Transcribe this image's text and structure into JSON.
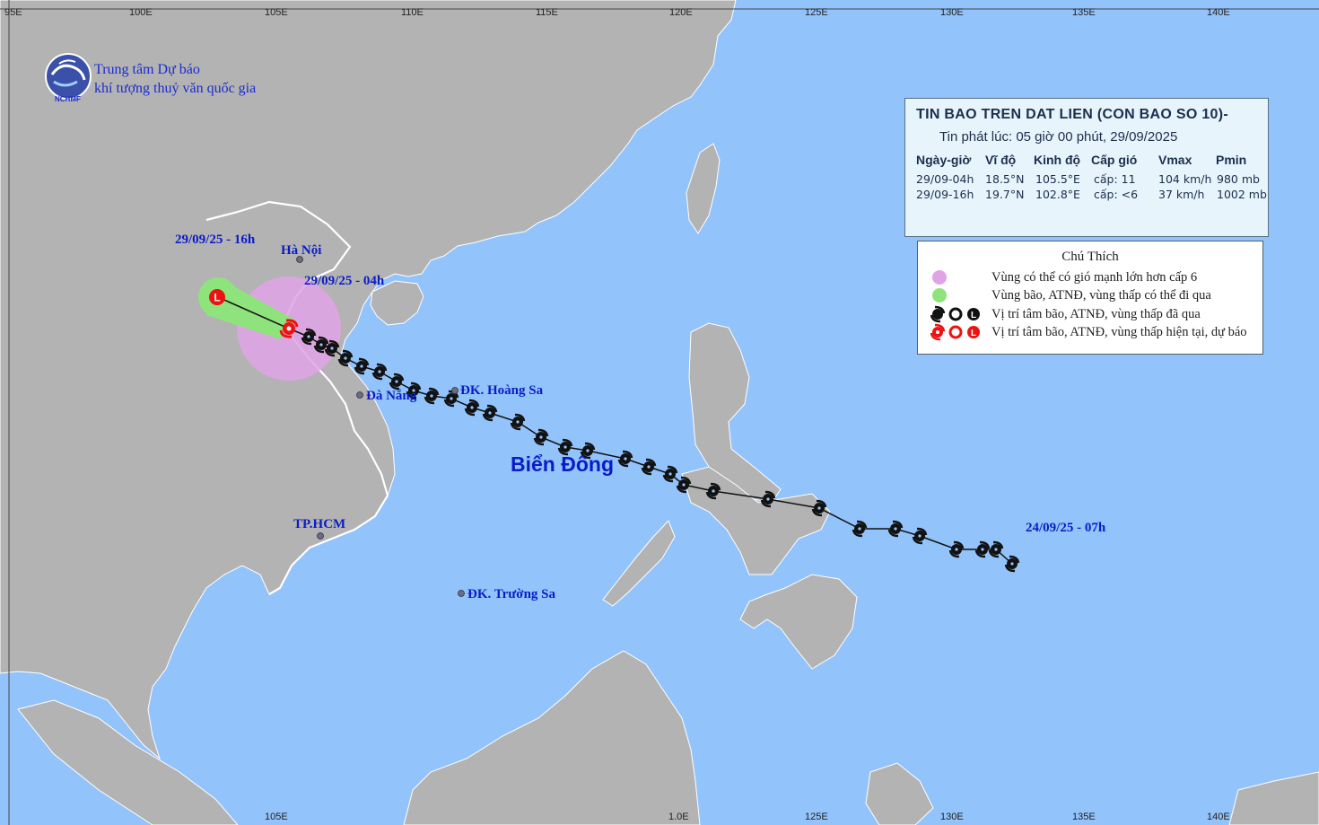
{
  "organization": {
    "line1": "Trung tâm Dự báo",
    "line2": "khí tượng thuỷ văn quốc gia",
    "logo_text": "NCHMF",
    "logo_icon": "nchmf-logo-icon"
  },
  "bulletin": {
    "title": "TIN BAO TREN DAT LIEN (CON BAO SO 10)-",
    "issued": "Tin phát lúc: 05 giờ 00 phút, 29/09/2025",
    "headers": [
      "Ngày-giờ",
      "Vĩ độ",
      "Kinh độ",
      "Cấp gió",
      "Vmax",
      "Pmin"
    ],
    "rows": [
      [
        "29/09-04h",
        "18.5°N",
        "105.5°E",
        "cấp: 11",
        "104 km/h",
        "980 mb"
      ],
      [
        "29/09-16h",
        "19.7°N",
        "102.8°E",
        "cấp: <6",
        "37 km/h",
        "1002 mb"
      ]
    ]
  },
  "legend": {
    "title": "Chú Thích",
    "items": [
      {
        "symbol": "circle",
        "color": "#e0a3e6",
        "text": "Vùng có thể có gió mạnh lớn hơn cấp 6"
      },
      {
        "symbol": "circle",
        "color": "#8fe37d",
        "text": "Vùng bão, ATNĐ, vùng thấp có thể đi qua"
      },
      {
        "symbol": "past-symbols",
        "color": "#111111",
        "text": "Vị trí tâm bão, ATNĐ, vùng thấp đã qua"
      },
      {
        "symbol": "current-symbols",
        "color": "#ee1111",
        "text": "Vị trí tâm bão, ATNĐ, vùng thấp hiện tại, dự báo"
      }
    ]
  },
  "places": {
    "hanoi": "Hà Nội",
    "danang": "Đà Nẵng",
    "hoangsa": "ĐK. Hoàng Sa",
    "hcm": "TP.HCM",
    "truongsa": "ĐK. Trường Sa",
    "sea": "Biển Đông"
  },
  "track_labels": {
    "start": "24/09/25 - 07h",
    "current": "29/09/25 - 04h",
    "forecast": "29/09/25 - 16h"
  },
  "axis": {
    "top": [
      "95E",
      "100E",
      "105E",
      "110E",
      "115E",
      "120E",
      "125E",
      "130E",
      "135E",
      "140E"
    ],
    "bottom": [
      "105E",
      "1.0E",
      "125E",
      "130E",
      "135E",
      "140E"
    ]
  },
  "colors": {
    "ocean": "#92c3fb",
    "land": "#b3b3b3",
    "wind_zone": "#e0a3e6",
    "forecast_cone": "#8fe37d",
    "storm_current": "#ee1111",
    "storm_past": "#111111",
    "label": "#0a1cc8"
  },
  "storm_track": {
    "past_symbol": "typhoon-icon",
    "current_symbol": "typhoon-icon",
    "forecast_symbol": "low-pressure-L-icon",
    "positions": [
      {
        "time": "29/09-04h",
        "lat": 18.5,
        "lon": 105.5,
        "type": "current"
      },
      {
        "time": "29/09-16h",
        "lat": 19.7,
        "lon": 102.8,
        "type": "forecast"
      }
    ]
  }
}
